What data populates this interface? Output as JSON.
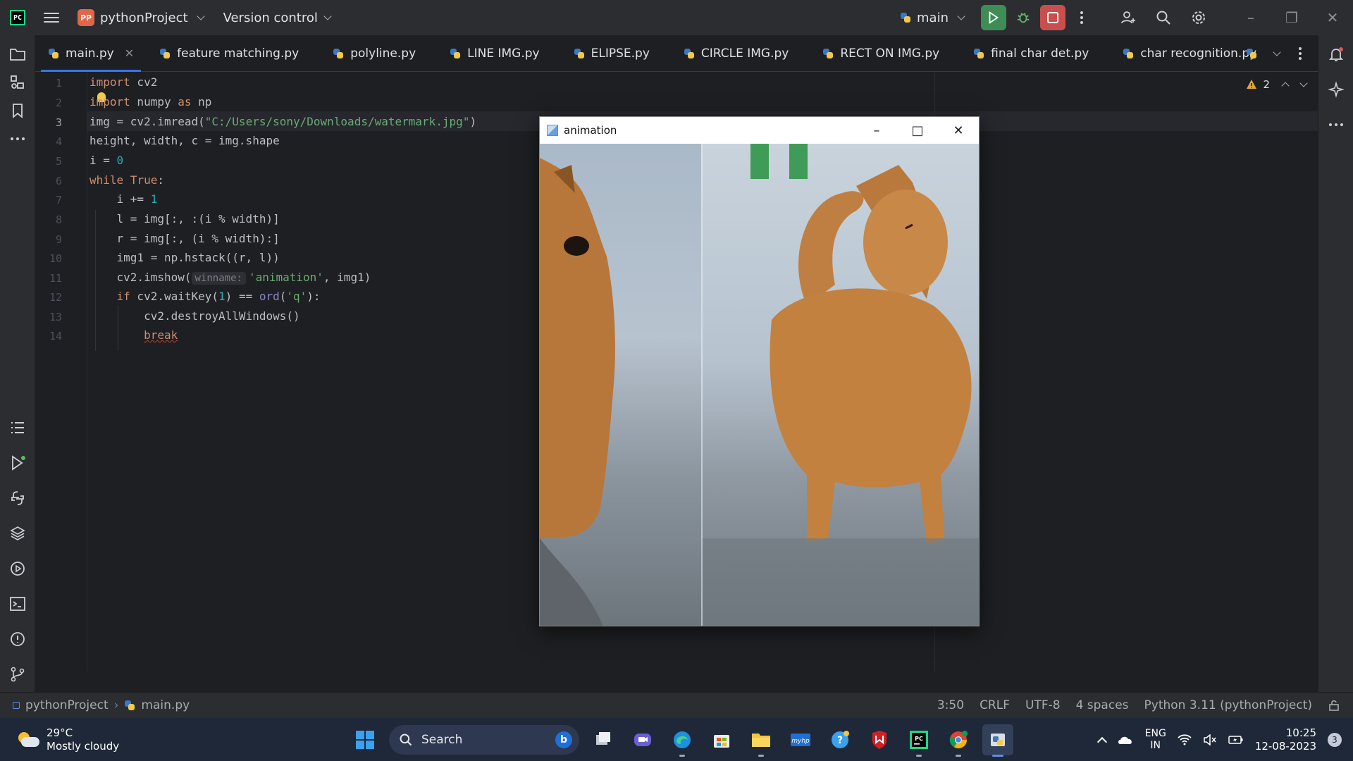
{
  "titlebar": {
    "badge": "PP",
    "project": "pythonProject",
    "vcs": "Version control",
    "branch": "main"
  },
  "tabs": [
    {
      "label": "main.py",
      "active": true
    },
    {
      "label": "feature matching.py"
    },
    {
      "label": "polyline.py"
    },
    {
      "label": "LINE IMG.py"
    },
    {
      "label": "ELIPSE.py"
    },
    {
      "label": "CIRCLE IMG.py"
    },
    {
      "label": "RECT ON IMG.py"
    },
    {
      "label": "final char det.py"
    },
    {
      "label": "char recognition.py"
    }
  ],
  "editor": {
    "line_numbers": [
      "1",
      "2",
      "3",
      "4",
      "5",
      "6",
      "7",
      "8",
      "9",
      "10",
      "11",
      "12",
      "13",
      "14"
    ],
    "current_line": "3",
    "warnings_count": "2",
    "lines": [
      {
        "kw": "import",
        "rest": " cv2"
      },
      {
        "kw": "import",
        "rest": " numpy ",
        "kw2": "as",
        "rest2": " np"
      },
      {
        "pre": "img = cv2.imread(",
        "str": "\"C:/Users/sony/Downloads/watermark.jpg\"",
        "post": ")"
      },
      {
        "pre": "height, width, c = img.shape"
      },
      {
        "pre": "i = ",
        "num": "0"
      },
      {
        "kw": "while",
        "rest": " ",
        "kw2": "True",
        "rest2": ":"
      },
      {
        "pre": "    i += ",
        "num": "1"
      },
      {
        "pre": "    l = img[:, :(i % width)]"
      },
      {
        "pre": "    r = img[:, (i % width):]"
      },
      {
        "pre": "    img1 = np.hstack((r, l))"
      },
      {
        "pre": "    cv2.imshow(",
        "hint": "winname:",
        "str": "'animation'",
        "post": ", img1)"
      },
      {
        "pre": "    ",
        "kw": "if",
        "mid": " cv2.waitKey(",
        "num": "1",
        "mid2": ") == ",
        "bi": "ord",
        "mid3": "(",
        "str": "'q'",
        "post": "):"
      },
      {
        "pre": "        cv2.destroyAllWindows()"
      },
      {
        "pre": "        ",
        "kw": "break"
      }
    ]
  },
  "cv_window": {
    "title": "animation"
  },
  "statusbar": {
    "project": "pythonProject",
    "file": "main.py",
    "position": "3:50",
    "line_sep": "CRLF",
    "encoding": "UTF-8",
    "indent": "4 spaces",
    "interpreter": "Python 3.11 (pythonProject)"
  },
  "taskbar": {
    "temperature": "29°C",
    "weather": "Mostly cloudy",
    "search_placeholder": "Search",
    "lang": "ENG",
    "region": "IN",
    "time": "10:25",
    "date": "12-08-2023",
    "notifications": "3"
  },
  "colors": {
    "accent": "#3574f0",
    "run": "#3f8d55",
    "stop": "#c94f4f"
  }
}
